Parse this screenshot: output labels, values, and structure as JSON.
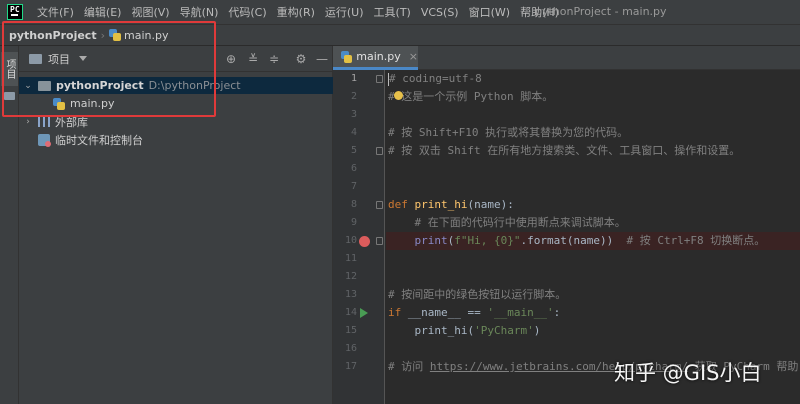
{
  "menubar": {
    "items": [
      "文件(F)",
      "编辑(E)",
      "视图(V)",
      "导航(N)",
      "代码(C)",
      "重构(R)",
      "运行(U)",
      "工具(T)",
      "VCS(S)",
      "窗口(W)",
      "帮助(H)"
    ],
    "window_title": "pythonProject - main.py"
  },
  "navbar": {
    "project": "pythonProject",
    "file": "main.py"
  },
  "leftstrip": {
    "label": "项目"
  },
  "project_panel": {
    "title": "项目",
    "tree": {
      "root_name": "pythonProject",
      "root_path": "D:\\pythonProject",
      "file": "main.py",
      "external_libs": "外部库",
      "scratches": "临时文件和控制台"
    }
  },
  "editor": {
    "tab_label": "main.py",
    "tab_close": "×",
    "line_numbers": [
      "1",
      "2",
      "3",
      "4",
      "5",
      "6",
      "7",
      "8",
      "9",
      "10",
      "11",
      "12",
      "13",
      "14",
      "15",
      "16",
      "17"
    ],
    "lines": {
      "l1": "# coding=utf-8",
      "l2": "# 这是一个示例 Python 脚本。",
      "l4": "# 按 Shift+F10 执行或将其替换为您的代码。",
      "l5": "# 按 双击 Shift 在所有地方搜索类、文件、工具窗口、操作和设置。",
      "l8_kw": "def ",
      "l8_fn": "print_hi",
      "l8_rest": "(name):",
      "l9": "    # 在下面的代码行中使用断点来调试脚本。",
      "l10_indent": "    ",
      "l10_bi": "print",
      "l10_p1": "(",
      "l10_str": "f\"Hi, {0}\"",
      "l10_p2": ".format(name))  ",
      "l10_cmt": "# 按 Ctrl+F8 切换断点。",
      "l13": "# 按间距中的绿色按钮以运行脚本。",
      "l14_kw": "if ",
      "l14_a": "__name__ == ",
      "l14_str": "'__main__'",
      "l14_b": ":",
      "l15_a": "    print_hi(",
      "l15_str": "'PyCharm'",
      "l15_b": ")",
      "l17_a": "# 访问 ",
      "l17_url": "https://www.jetbrains.com/help/pycharm/",
      "l17_b": " 获取 PyCharm 帮助"
    }
  },
  "watermark": "知乎 @GIS小白",
  "colors": {
    "highlight": "#e03a3a",
    "accent": "#4a88c7"
  }
}
